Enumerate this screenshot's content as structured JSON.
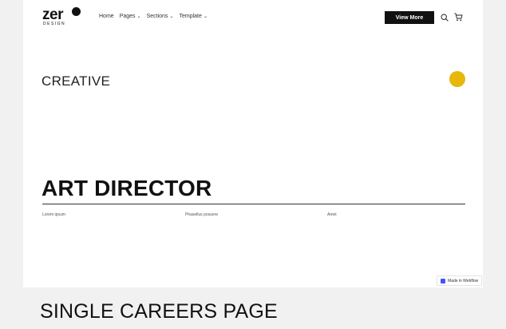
{
  "logo": {
    "word": "zer",
    "sub": "DESIGN"
  },
  "nav": {
    "items": [
      {
        "label": "Home",
        "dropdown": false
      },
      {
        "label": "Pages",
        "dropdown": true
      },
      {
        "label": "Sections",
        "dropdown": true
      },
      {
        "label": "Template",
        "dropdown": true
      }
    ],
    "cta": "View More"
  },
  "hero": {
    "eyebrow": "CREATIVE",
    "title": "ART DIRECTOR"
  },
  "meta": {
    "col1": "Lorem ipsum",
    "col2": "Phasellus posuere",
    "col3": "Amet"
  },
  "badge": {
    "label": "Made in Webflow"
  },
  "caption": "SINGLE CAREERS PAGE",
  "colors": {
    "accent": "#e7b80a",
    "primary": "#111111",
    "webflow": "#4353ff"
  }
}
